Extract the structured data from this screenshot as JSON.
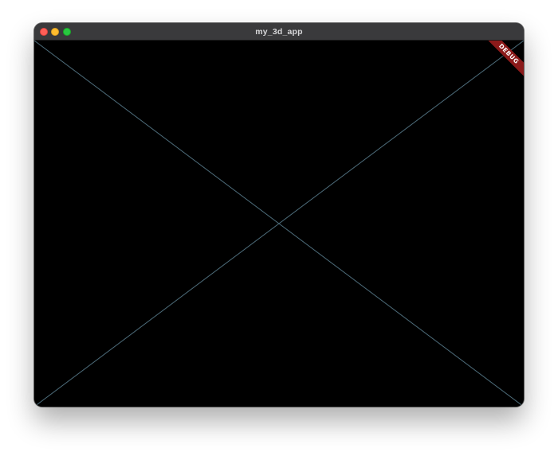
{
  "window": {
    "title": "my_3d_app"
  },
  "debug_banner": {
    "label": "DEBUG",
    "color": "#8b1a1a"
  },
  "canvas": {
    "background": "#000000",
    "line_color": "#4d6c7a"
  }
}
